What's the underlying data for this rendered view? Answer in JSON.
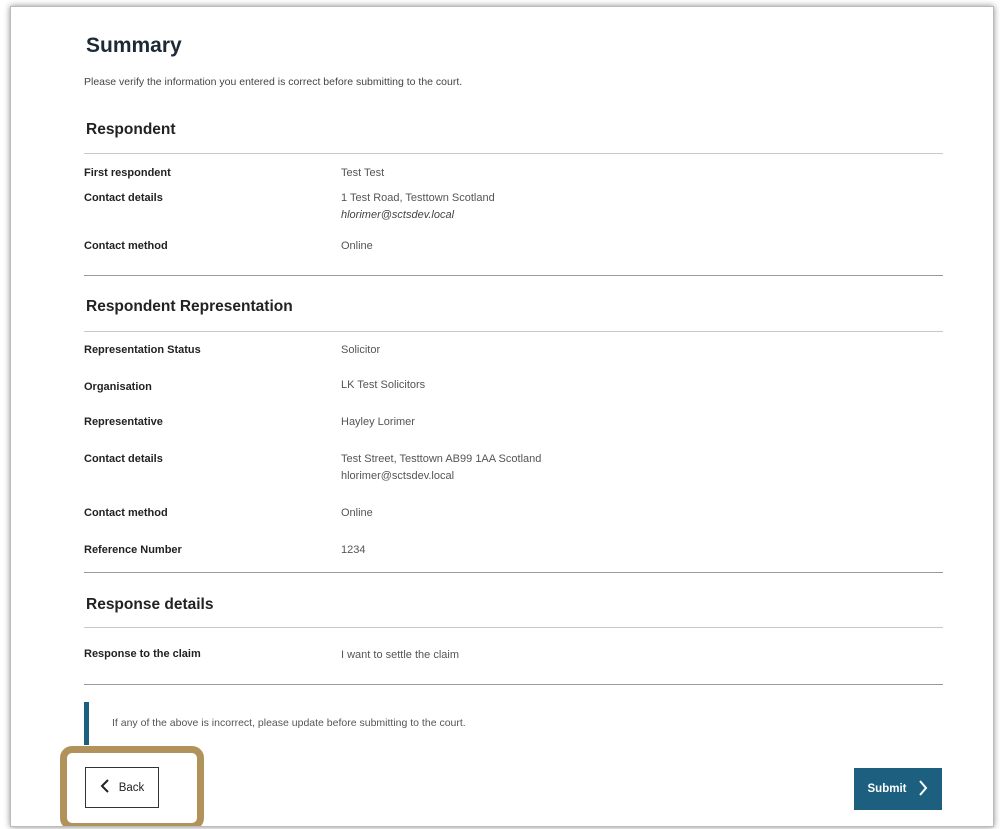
{
  "page": {
    "title": "Summary",
    "intro": "Please verify the information you entered is correct before submitting to the court."
  },
  "respondent": {
    "heading": "Respondent",
    "rows": [
      {
        "label": "First respondent",
        "value": "Test Test"
      },
      {
        "label": "Contact details",
        "value": "1 Test Road, Testtown Scotland",
        "email": "hlorimer@sctsdev.local"
      },
      {
        "label": "Contact method",
        "value": "Online"
      }
    ]
  },
  "representation": {
    "heading": "Respondent Representation",
    "rows": [
      {
        "label": "Representation Status",
        "value": "Solicitor"
      },
      {
        "label": "Organisation",
        "value": "LK Test Solicitors"
      },
      {
        "label": "Representative",
        "value": "Hayley Lorimer"
      },
      {
        "label": "Contact details",
        "value": "Test Street, Testtown AB99 1AA Scotland",
        "email": "hlorimer@sctsdev.local"
      },
      {
        "label": "Contact method",
        "value": "Online"
      },
      {
        "label": "Reference Number",
        "value": "1234"
      }
    ]
  },
  "response": {
    "heading": "Response details",
    "rows": [
      {
        "label": "Response to the claim",
        "value": "I want to settle the claim"
      }
    ]
  },
  "notice": {
    "text": "If any of the above is incorrect, please update before submitting to the court."
  },
  "actions": {
    "back_label": "Back",
    "back_icon": "chevron-left-icon",
    "submit_label": "Submit",
    "submit_icon": "chevron-right-icon"
  },
  "colors": {
    "accent": "#1d5f7f",
    "highlight": "#b0925a"
  }
}
